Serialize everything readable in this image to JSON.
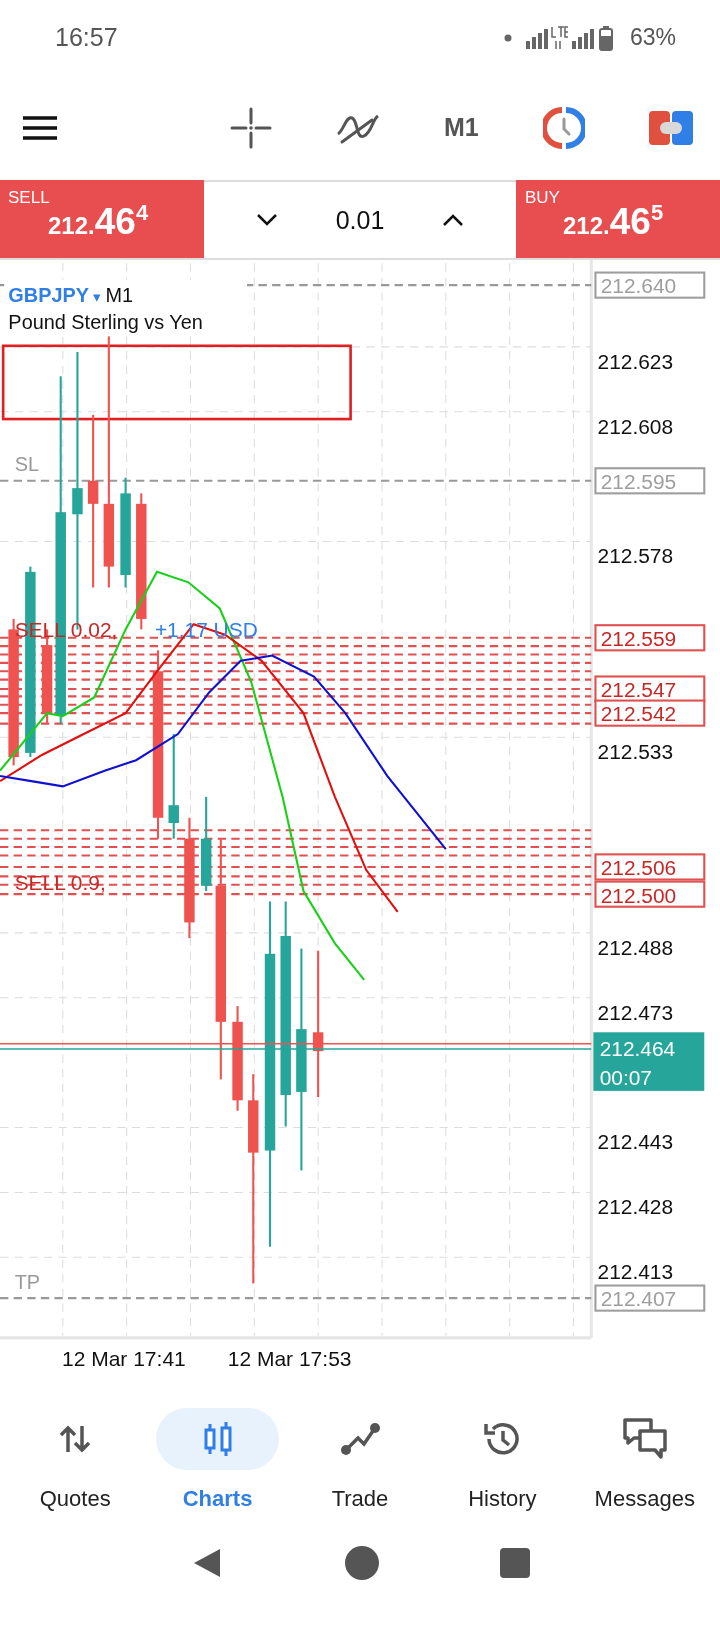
{
  "status_bar": {
    "time": "16:57",
    "battery": "63%"
  },
  "toolbar": {
    "timeframe": "M1"
  },
  "trade_bar": {
    "sell": {
      "label": "SELL",
      "price_prefix": "212.",
      "price_big": "46",
      "price_sup": "4"
    },
    "volume": "0.01",
    "buy": {
      "label": "BUY",
      "price_prefix": "212.",
      "price_big": "46",
      "price_sup": "5"
    }
  },
  "chart": {
    "symbol": "GBPJPY",
    "symbol_caret": "▾",
    "timeframe": "M1",
    "description": "Pound Sterling vs Yen",
    "price_labels": [
      {
        "kind": "level",
        "text": "212.640"
      },
      {
        "kind": "tick",
        "text": "212.623"
      },
      {
        "kind": "tick",
        "text": "212.608"
      },
      {
        "kind": "level",
        "text": "212.595"
      },
      {
        "kind": "tick",
        "text": "212.578"
      },
      {
        "kind": "order",
        "text": "212.559"
      },
      {
        "kind": "order",
        "text": "212.547"
      },
      {
        "kind": "order",
        "text": "212.542"
      },
      {
        "kind": "tick",
        "text": "212.533"
      },
      {
        "kind": "order",
        "text": "212.506"
      },
      {
        "kind": "order",
        "text": "212.500"
      },
      {
        "kind": "tick",
        "text": "212.488"
      },
      {
        "kind": "tick",
        "text": "212.473"
      },
      {
        "kind": "current",
        "text": "212.464",
        "sub": "00:07"
      },
      {
        "kind": "tick",
        "text": "212.443"
      },
      {
        "kind": "tick",
        "text": "212.428"
      },
      {
        "kind": "tick",
        "text": "212.413"
      },
      {
        "kind": "level",
        "text": "212.407"
      }
    ],
    "line_labels": [
      "SL",
      "TP"
    ],
    "order_labels": [
      {
        "side": "SELL 0.02,",
        "profit": "+1.17 USD"
      },
      {
        "side": "SELL 0.9,"
      }
    ],
    "time_labels": [
      "12 Mar 17:41",
      "12 Mar 17:53"
    ]
  },
  "bottom_nav": [
    {
      "label": "Quotes",
      "selected": false
    },
    {
      "label": "Charts",
      "selected": true
    },
    {
      "label": "Trade",
      "selected": false
    },
    {
      "label": "History",
      "selected": false
    },
    {
      "label": "Messages",
      "selected": false
    }
  ]
}
